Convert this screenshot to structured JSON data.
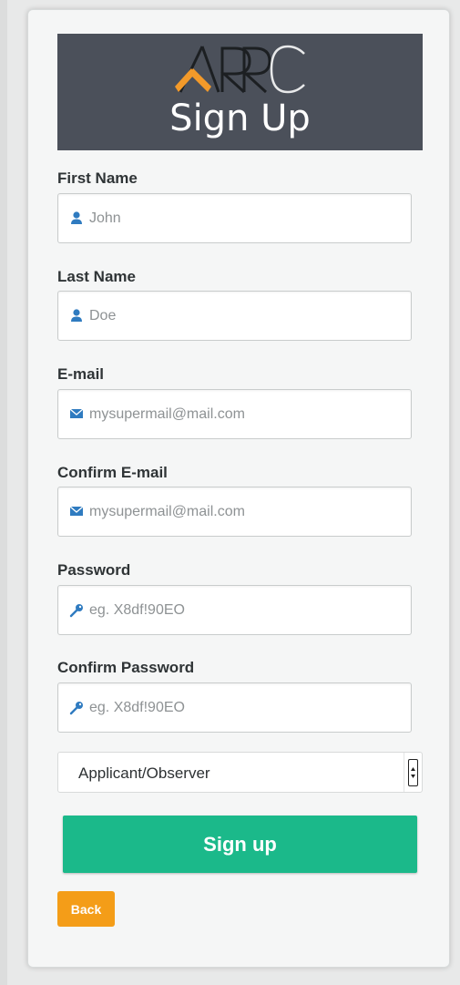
{
  "header": {
    "logo_text": "ARRC",
    "title": "Sign Up"
  },
  "form": {
    "fields": [
      {
        "label": "First Name",
        "placeholder": "John",
        "icon": "user-icon"
      },
      {
        "label": "Last Name",
        "placeholder": "Doe",
        "icon": "user-icon"
      },
      {
        "label": "E-mail",
        "placeholder": "mysupermail@mail.com",
        "icon": "envelope-icon"
      },
      {
        "label": "Confirm E-mail",
        "placeholder": "mysupermail@mail.com",
        "icon": "envelope-icon"
      },
      {
        "label": "Password",
        "placeholder": "eg. X8df!90EO",
        "icon": "key-icon"
      },
      {
        "label": "Confirm Password",
        "placeholder": "eg. X8df!90EO",
        "icon": "key-icon"
      }
    ],
    "role_select": {
      "selected": "Applicant/Observer"
    },
    "signup_label": "Sign up",
    "back_label": "Back"
  },
  "colors": {
    "header_bg": "#4b505a",
    "logo_accent": "#f39a2a",
    "icon_blue": "#2f7bc0",
    "signup_green": "#1bb98a",
    "back_orange": "#f49d18"
  }
}
